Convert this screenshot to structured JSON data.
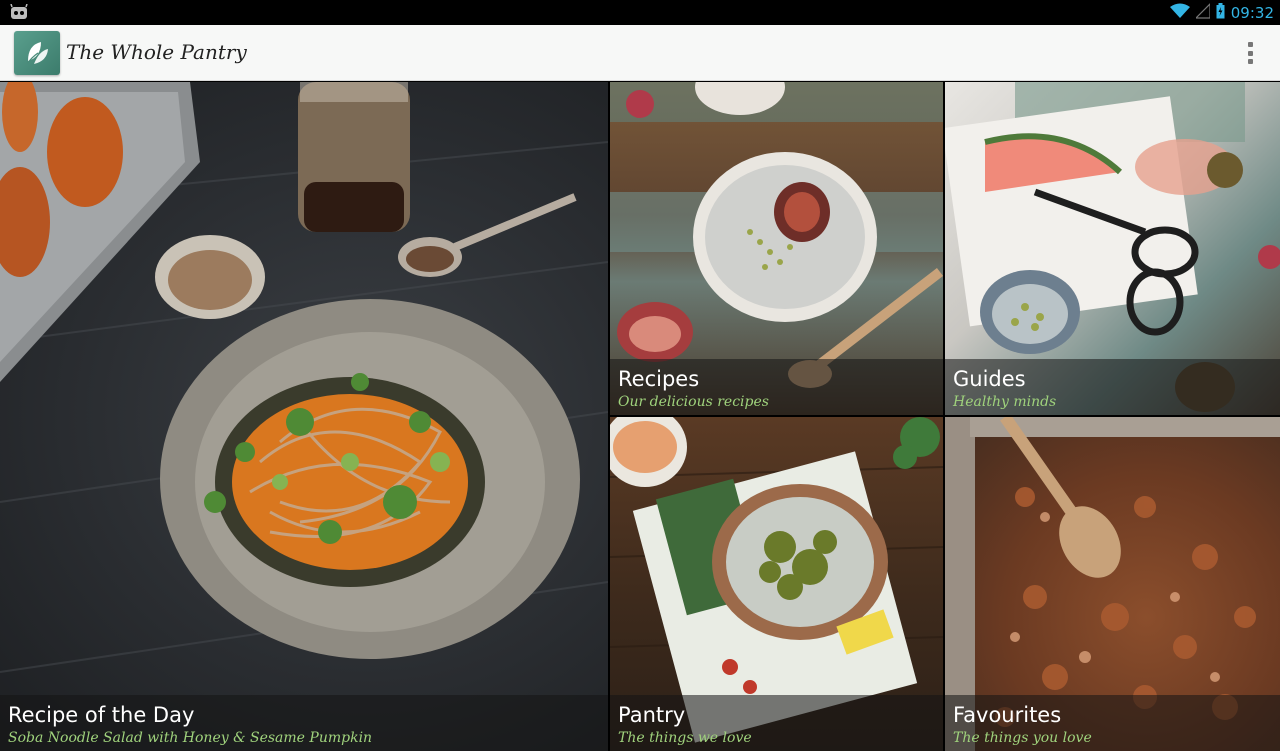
{
  "status_bar": {
    "time": "09:32",
    "icons": [
      "android-icon",
      "wifi-icon",
      "signal-icon",
      "battery-charging-icon"
    ]
  },
  "action_bar": {
    "title": "The Whole Pantry",
    "app_icon": "leaf-icon",
    "overflow_icon": "more-vert-icon"
  },
  "tiles": [
    {
      "title": "Recipe of the Day",
      "subtitle": "Soba Noodle Salad with Honey & Sesame Pumpkin"
    },
    {
      "title": "Recipes",
      "subtitle": "Our delicious recipes"
    },
    {
      "title": "Guides",
      "subtitle": "Healthy minds"
    },
    {
      "title": "Pantry",
      "subtitle": "The things we love"
    },
    {
      "title": "Favourites",
      "subtitle": "The things you love"
    }
  ],
  "colors": {
    "accent_blue": "#33b5e5",
    "subtitle_green": "#9fd27c",
    "app_icon_teal": "#4a8c7b"
  }
}
